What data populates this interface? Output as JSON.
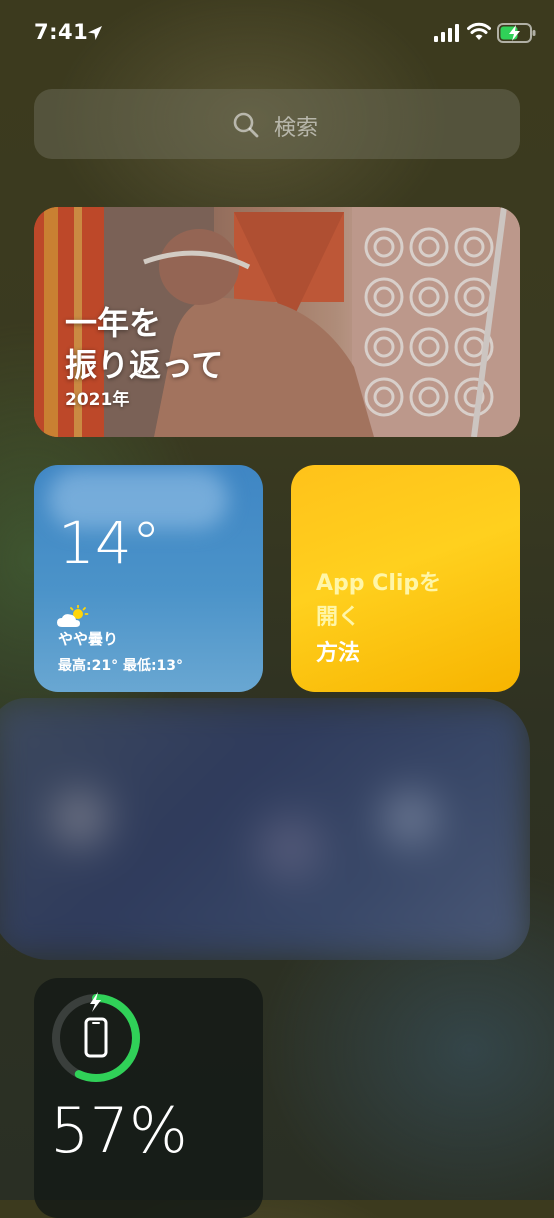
{
  "status_bar": {
    "time": "7:41",
    "battery_level": 0.57,
    "charging": true
  },
  "search": {
    "placeholder": "検索"
  },
  "memories_widget": {
    "title": "一年を\n振り返って",
    "year": "2021年"
  },
  "weather_widget": {
    "temperature": "14°",
    "condition": "やや曇り",
    "high_low": "最高:21° 最低:13°",
    "icon": "partly-cloudy-icon"
  },
  "tips_widget": {
    "line1": "App Clipを",
    "line2": "開く",
    "line3": "方法"
  },
  "battery_widget": {
    "percent": "57%",
    "level": 0.57,
    "icon": "iphone-icon",
    "accent": "#30d158"
  }
}
